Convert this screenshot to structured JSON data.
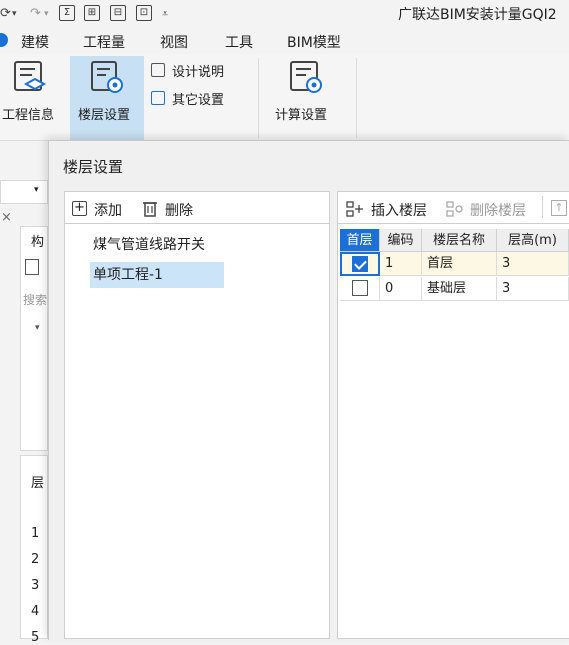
{
  "quick_access": {
    "arrow": "▾",
    "sigma": "Σ",
    "eq": "⊟"
  },
  "app": {
    "title": "广联达BIM安装计量GQI2"
  },
  "menu": {
    "items": [
      "建模",
      "工程量",
      "视图",
      "工具",
      "BIM模型"
    ]
  },
  "ribbon": {
    "project_info": "工程信息",
    "floor_settings": "楼层设置",
    "design_notes": "设计说明",
    "other_settings": "其它设置",
    "calc_settings": "计算设置"
  },
  "bg_panel": {
    "construct": "构",
    "search": "搜索",
    "floor": "层",
    "rows": [
      "1",
      "2",
      "3",
      "4",
      "5"
    ],
    "close": "×"
  },
  "dialog": {
    "title": "楼层设置",
    "left_toolbar": {
      "add": "添加",
      "delete": "删除"
    },
    "tree": [
      "煤气管道线路开关",
      "单项工程-1"
    ],
    "right_toolbar": {
      "insert": "插入楼层",
      "delete": "删除楼层"
    },
    "grid": {
      "headers": [
        "首层",
        "编码",
        "楼层名称",
        "层高(m)"
      ],
      "rows": [
        {
          "first": true,
          "code": "1",
          "name": "首层",
          "height": "3"
        },
        {
          "first": false,
          "code": "0",
          "name": "基础层",
          "height": "3"
        }
      ]
    }
  },
  "colors": {
    "accent": "#1b6fd6",
    "selection": "#cce4f7",
    "ribbon_active": "#c7e0f4"
  }
}
